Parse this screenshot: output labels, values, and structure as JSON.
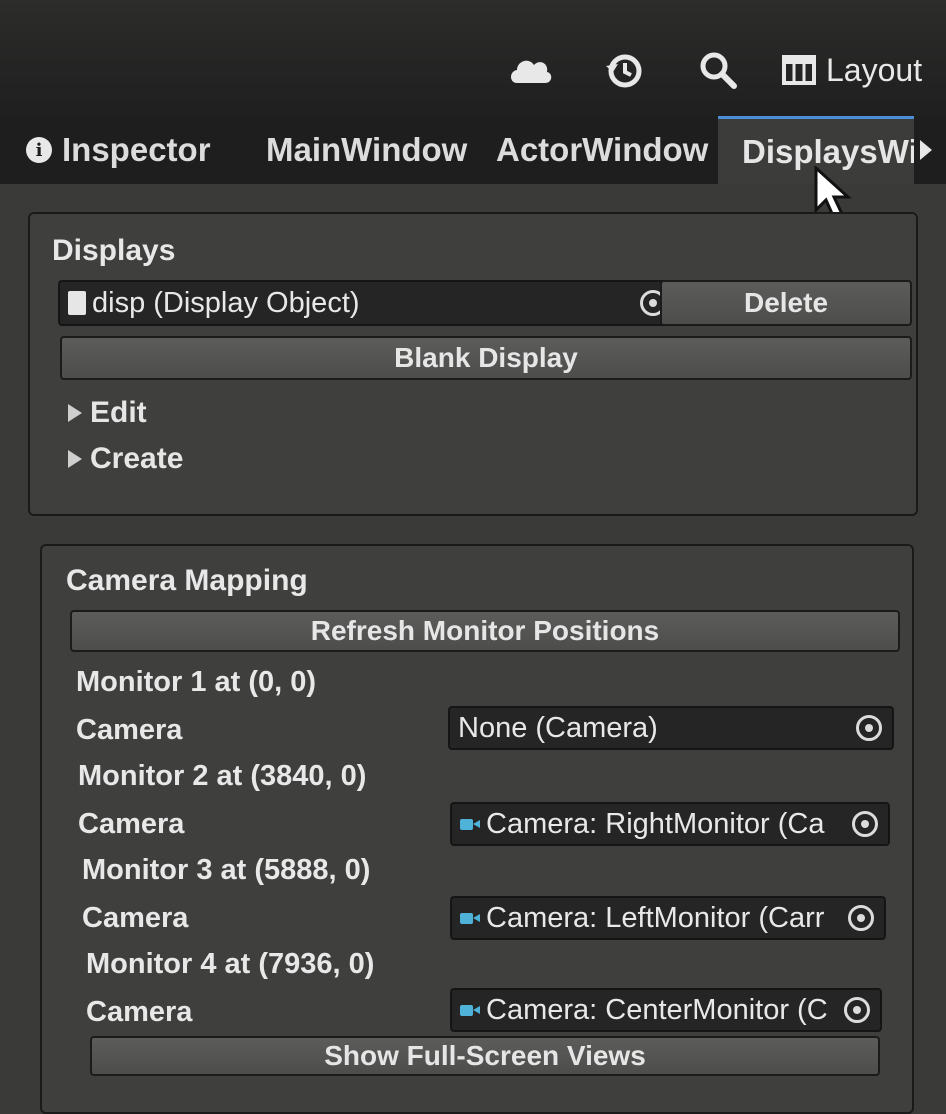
{
  "toolbar": {
    "icons": [
      "cloud-icon",
      "history-icon",
      "search-icon"
    ],
    "layout_label": "Layout"
  },
  "tabs": [
    {
      "label": "Inspector",
      "icon": "info-icon"
    },
    {
      "label": "MainWindow"
    },
    {
      "label": "ActorWindow"
    },
    {
      "label": "DisplaysWi",
      "active": true
    }
  ],
  "displays": {
    "title": "Displays",
    "object_field": "disp (Display Object)",
    "delete_label": "Delete",
    "blank_label": "Blank Display",
    "foldouts": [
      "Edit",
      "Create"
    ]
  },
  "camera_mapping": {
    "title": "Camera Mapping",
    "refresh_label": "Refresh Monitor Positions",
    "monitors": [
      {
        "label": "Monitor 1 at (0, 0)",
        "camera_label": "Camera",
        "camera_value": "None (Camera)",
        "has_icon": false
      },
      {
        "label": "Monitor 2 at (3840, 0)",
        "camera_label": "Camera",
        "camera_value": "Camera: RightMonitor (Ca",
        "has_icon": true
      },
      {
        "label": "Monitor 3 at (5888, 0)",
        "camera_label": "Camera",
        "camera_value": "Camera: LeftMonitor (Carr",
        "has_icon": true
      },
      {
        "label": "Monitor 4 at (7936, 0)",
        "camera_label": "Camera",
        "camera_value": "Camera: CenterMonitor (C",
        "has_icon": true
      }
    ],
    "fullscreen_label": "Show Full-Screen Views"
  },
  "colors": {
    "accent": "#4a8fd8",
    "camera_icon": "#4fb3d9"
  }
}
